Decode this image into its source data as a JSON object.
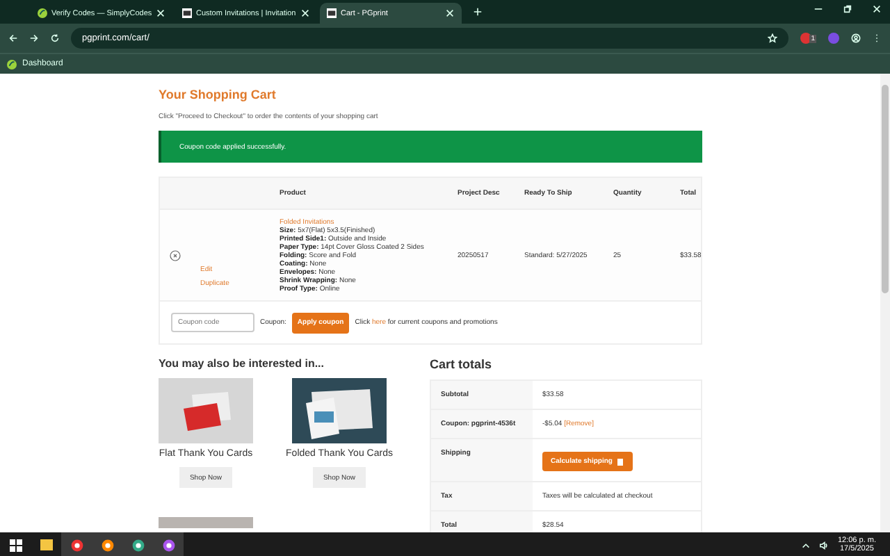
{
  "browser": {
    "tabs": [
      {
        "title": "Verify Codes — SimplyCodes",
        "selected": false
      },
      {
        "title": "Custom Invitations | Invitation",
        "selected": false
      },
      {
        "title": "Cart - PGprint",
        "selected": true
      }
    ],
    "url": "pgprint.com/cart/",
    "bookmarks": [
      {
        "label": "Dashboard"
      }
    ],
    "extension_badge": "1"
  },
  "page": {
    "title": "Your Shopping Cart",
    "subtitle": "Click \"Proceed to Checkout\" to order the contents of your shopping cart",
    "notice": "Coupon code applied successfully.",
    "table": {
      "columns": [
        "Product",
        "Project Desc",
        "Ready To Ship",
        "Quantity",
        "Total"
      ],
      "rows": [
        {
          "product_name": "Folded Invitations",
          "details": [
            {
              "label": "Size:",
              "value": "5x7(Flat) 5x3.5(Finished)"
            },
            {
              "label": "Printed Side1:",
              "value": "Outside and Inside"
            },
            {
              "label": "Paper Type:",
              "value": "14pt Cover Gloss Coated 2 Sides"
            },
            {
              "label": "Folding:",
              "value": "Score and Fold"
            },
            {
              "label": "Coating:",
              "value": "None"
            },
            {
              "label": "Envelopes:",
              "value": "None"
            },
            {
              "label": "Shrink Wrapping:",
              "value": "None"
            },
            {
              "label": "Proof Type:",
              "value": "Online"
            }
          ],
          "actions": [
            "Edit",
            "Duplicate"
          ],
          "project_desc": "20250517",
          "ready_to_ship": "Standard: 5/27/2025",
          "quantity": "25",
          "total": "$33.58"
        }
      ]
    },
    "coupon": {
      "placeholder": "Coupon code",
      "label": "Coupon:",
      "button": "Apply coupon",
      "hint_before": "Click",
      "hint_link": "here",
      "hint_after": "for current coupons and promotions"
    },
    "related": {
      "heading": "You may also be interested in...",
      "products": [
        {
          "name": "Flat Thank You Cards",
          "button": "Shop Now"
        },
        {
          "name": "Folded Thank You Cards",
          "button": "Shop Now"
        }
      ]
    },
    "totals": {
      "heading": "Cart totals",
      "rows": [
        {
          "kind": "text",
          "label": "Subtotal",
          "value": "$33.58"
        },
        {
          "kind": "coupon",
          "label": "Coupon: pgprint-4536t",
          "value": "-$5.04",
          "link": "[Remove]"
        },
        {
          "kind": "button",
          "label": "Shipping",
          "value": "Calculate shipping"
        },
        {
          "kind": "text",
          "label": "Tax",
          "value": "Taxes will be calculated at checkout"
        },
        {
          "kind": "text",
          "label": "Total",
          "value": "$28.54"
        }
      ]
    }
  },
  "taskbar": {
    "time": "12:06 p. m.",
    "date": "17/5/2025"
  }
}
